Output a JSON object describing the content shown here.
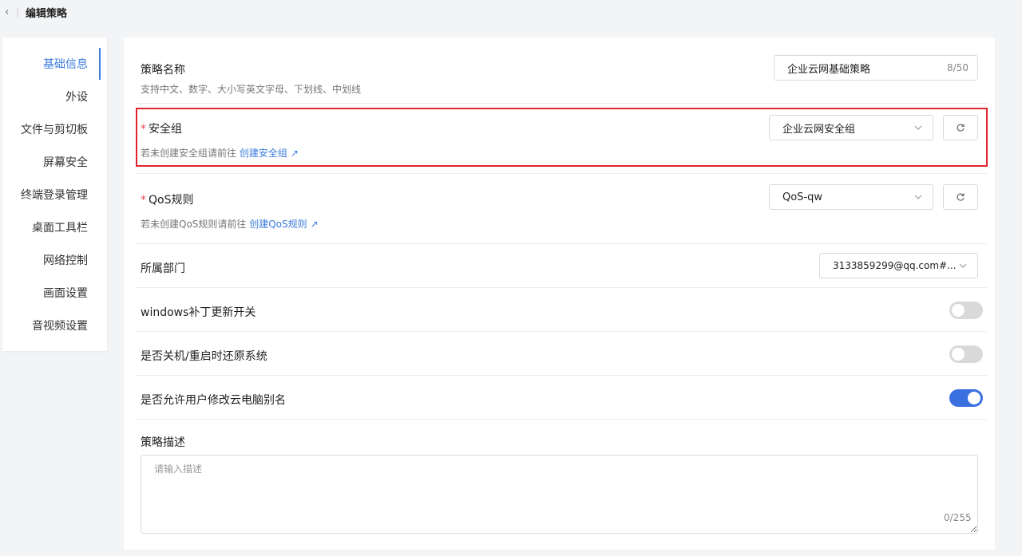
{
  "header": {
    "back_icon": "‹",
    "separator": "|",
    "title": "编辑策略"
  },
  "sidebar": {
    "items": [
      {
        "label": "基础信息",
        "active": true
      },
      {
        "label": "外设",
        "active": false
      },
      {
        "label": "文件与剪切板",
        "active": false
      },
      {
        "label": "屏幕安全",
        "active": false
      },
      {
        "label": "终端登录管理",
        "active": false
      },
      {
        "label": "桌面工具栏",
        "active": false
      },
      {
        "label": "网络控制",
        "active": false
      },
      {
        "label": "画面设置",
        "active": false
      },
      {
        "label": "音视频设置",
        "active": false
      }
    ]
  },
  "form": {
    "policy_name": {
      "label": "策略名称",
      "hint": "支持中文、数字、大小写英文字母、下划线、中划线",
      "value": "企业云网基础策略",
      "count": "8/50"
    },
    "security_group": {
      "required_mark": "*",
      "label": "安全组",
      "value": "企业云网安全组",
      "hint_prefix": "若未创建安全组请前往",
      "link_text": "创建安全组",
      "link_icon": "↗"
    },
    "qos": {
      "required_mark": "*",
      "label": "QoS规则",
      "value": "QoS-qw",
      "hint_prefix": "若未创建QoS规则请前往",
      "link_text": "创建QoS规则",
      "link_icon": "↗"
    },
    "department": {
      "label": "所属部门",
      "value": "3133859299@qq.com#..."
    },
    "windows_patch": {
      "label": "windows补丁更新开关",
      "enabled": false
    },
    "restore_system": {
      "label": "是否关机/重启时还原系统",
      "enabled": false
    },
    "allow_rename": {
      "label": "是否允许用户修改云电脑别名",
      "enabled": true
    },
    "description": {
      "label": "策略描述",
      "placeholder": "请输入描述",
      "count": "0/255"
    }
  },
  "colors": {
    "accent": "#3a7bdc",
    "highlight_border": "#e0242d",
    "required": "#e5484d"
  }
}
